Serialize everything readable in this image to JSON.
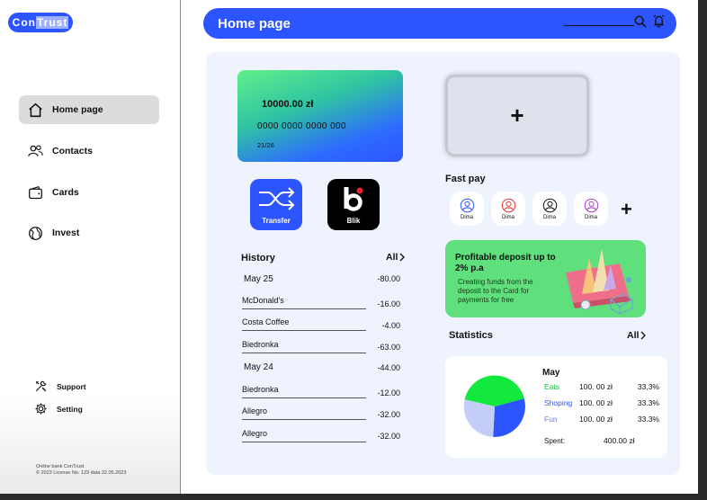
{
  "brand": {
    "name_prefix": "Con",
    "name_highlight": "Trust"
  },
  "header": {
    "title": "Home page"
  },
  "sidebar": {
    "items": [
      {
        "label": "Home page",
        "icon": "home-icon"
      },
      {
        "label": "Contacts",
        "icon": "contacts-icon"
      },
      {
        "label": "Cards",
        "icon": "wallet-icon"
      },
      {
        "label": "Invest",
        "icon": "globe-icon"
      }
    ],
    "bottom": [
      {
        "label": "Support",
        "icon": "tools-icon"
      },
      {
        "label": "Setting",
        "icon": "gear-icon"
      }
    ],
    "footer_line1": "Online bank ConTrust",
    "footer_line2": "© 2023 License No. 123 data 22.05.2023"
  },
  "card": {
    "balance": "10000.00 zł",
    "number": "0000 0000 0000 000",
    "expiry": "21/26"
  },
  "add_card": {
    "symbol": "+"
  },
  "quick_actions": {
    "transfer": "Transfer",
    "blik": "Blik"
  },
  "history": {
    "title": "History",
    "all_label": "All",
    "groups": [
      {
        "date": "May 25",
        "total": "-80.00",
        "items": [
          {
            "name": "McDonald's",
            "amount": "-16.00"
          },
          {
            "name": "Costa Coffee",
            "amount": "-4.00"
          },
          {
            "name": "Biedronka",
            "amount": "-63.00"
          }
        ]
      },
      {
        "date": "May 24",
        "total": "-44.00",
        "items": [
          {
            "name": "Biedronka",
            "amount": "-12.00"
          },
          {
            "name": "Allegro",
            "amount": "-32.00"
          },
          {
            "name": "Allegro",
            "amount": "-32.00"
          }
        ]
      }
    ]
  },
  "fast_pay": {
    "title": "Fast pay",
    "contacts": [
      {
        "name": "Dima",
        "color": "#2d55ff"
      },
      {
        "name": "Dima",
        "color": "#e53935"
      },
      {
        "name": "Dima",
        "color": "#111111"
      },
      {
        "name": "Dima",
        "color": "#b03cc9"
      }
    ],
    "add": "+"
  },
  "promo": {
    "title": "Profitable deposit  up to 2% p.a",
    "description": "Creating funds from the deposit to the Card for payments for free"
  },
  "statistics": {
    "title": "Statistics",
    "all_label": "All",
    "month": "May",
    "rows": [
      {
        "category": "Eats",
        "value": "100. 00 zł",
        "percent": "33,3%",
        "color": "#13c23a"
      },
      {
        "category": "Shoping",
        "value": "100. 00 zł",
        "percent": "33.3%",
        "color": "#2d55ff"
      },
      {
        "category": "Fun",
        "value": "100. 00 zł",
        "percent": "33.3%",
        "color": "#6b7fd8"
      }
    ],
    "spent_label": "Spent:",
    "spent_value": "400.00 zł"
  },
  "colors": {
    "accent": "#2d55ff",
    "panel": "#eef3fe",
    "promo": "#5fe07c"
  }
}
